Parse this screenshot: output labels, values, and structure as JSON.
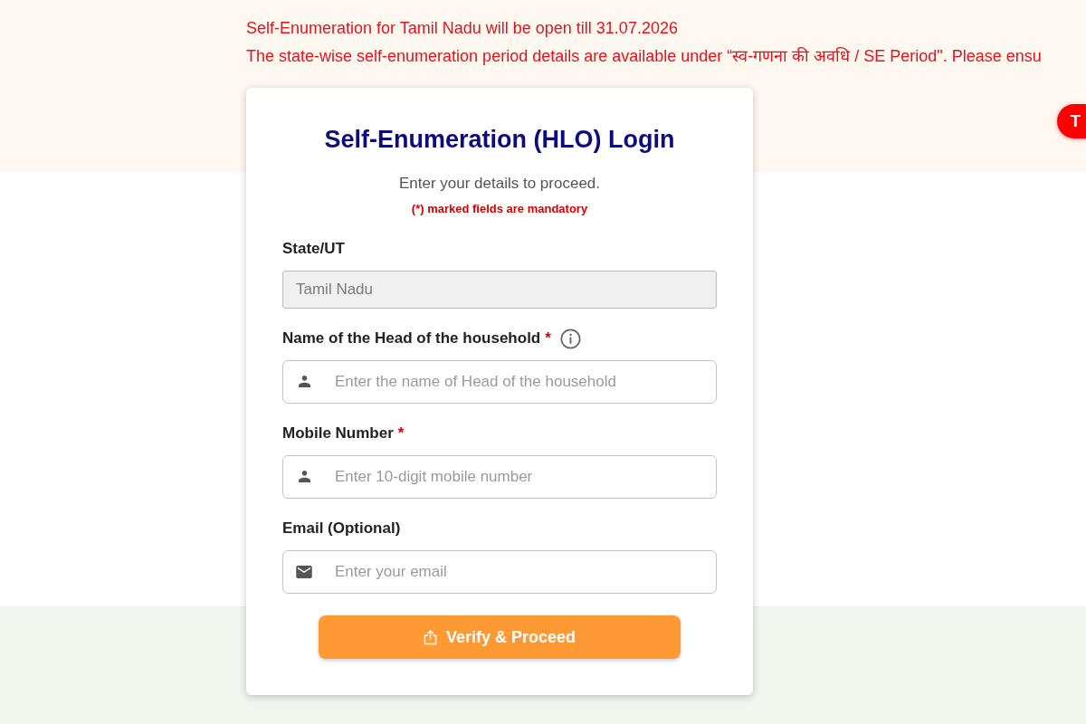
{
  "notices": [
    {
      "text": "Self-Enumeration for Tamil Nadu will be open till 31.07.2026"
    },
    {
      "text": "The state-wise self-enumeration period details are available under “स्व-गणना की अवधि / SE Period\". Please ensu"
    }
  ],
  "side_button": {
    "label": "T"
  },
  "login": {
    "title": "Self-Enumeration (HLO) Login",
    "subtitle": "Enter your details to proceed.",
    "note": "(*) marked fields are mandatory",
    "fields": [
      {
        "kind": "fixed",
        "label": "State/UT",
        "value": "Tamil Nadu",
        "disabled": true,
        "info": false
      },
      {
        "kind": "text",
        "label": "Name of the Head of the household",
        "required_mark": "*",
        "info": true,
        "placeholder": "Enter the name of Head of the household",
        "disabled": false
      },
      {
        "kind": "text",
        "label": "Mobile Number",
        "required_mark": "*",
        "info": false,
        "placeholder": "Enter 10-digit mobile number",
        "disabled": false
      },
      {
        "kind": "email",
        "label": "Email (Optional)",
        "info": false,
        "placeholder": "Enter your email",
        "disabled": false
      }
    ],
    "button": {
      "label": "Verify & Proceed"
    }
  }
}
